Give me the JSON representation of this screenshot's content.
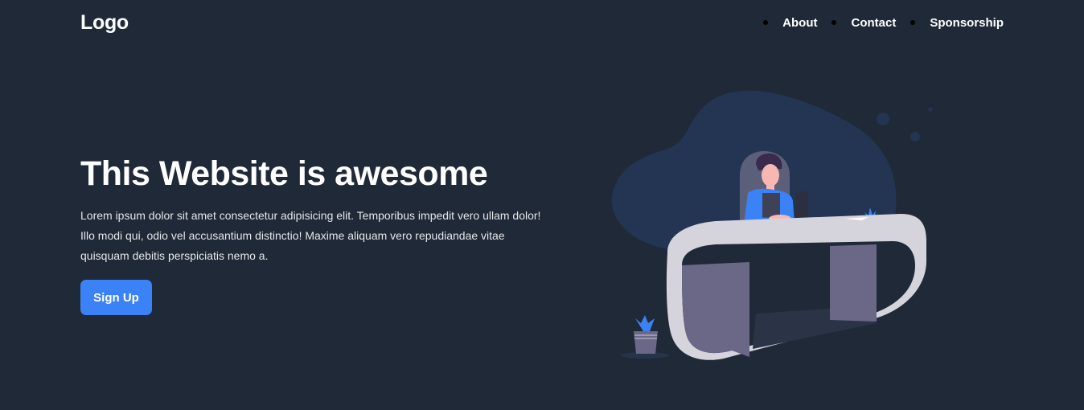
{
  "navbar": {
    "logo": "Logo",
    "links": [
      {
        "label": "About"
      },
      {
        "label": "Contact"
      },
      {
        "label": "Sponsorship"
      }
    ]
  },
  "hero": {
    "title": "This Website is awesome",
    "description": "Lorem ipsum dolor sit amet consectetur adipisicing elit. Temporibus impedit vero ullam dolor! Illo modi qui, odio vel accusantium distinctio! Maxime aliquam vero repudiandae vitae quisquam debitis perspiciatis nemo a.",
    "cta_label": "Sign Up"
  },
  "colors": {
    "background": "#1f2937",
    "accent": "#3b82f6",
    "text": "#ffffff"
  },
  "illustration": {
    "icon": "person-at-desk-illustration"
  }
}
